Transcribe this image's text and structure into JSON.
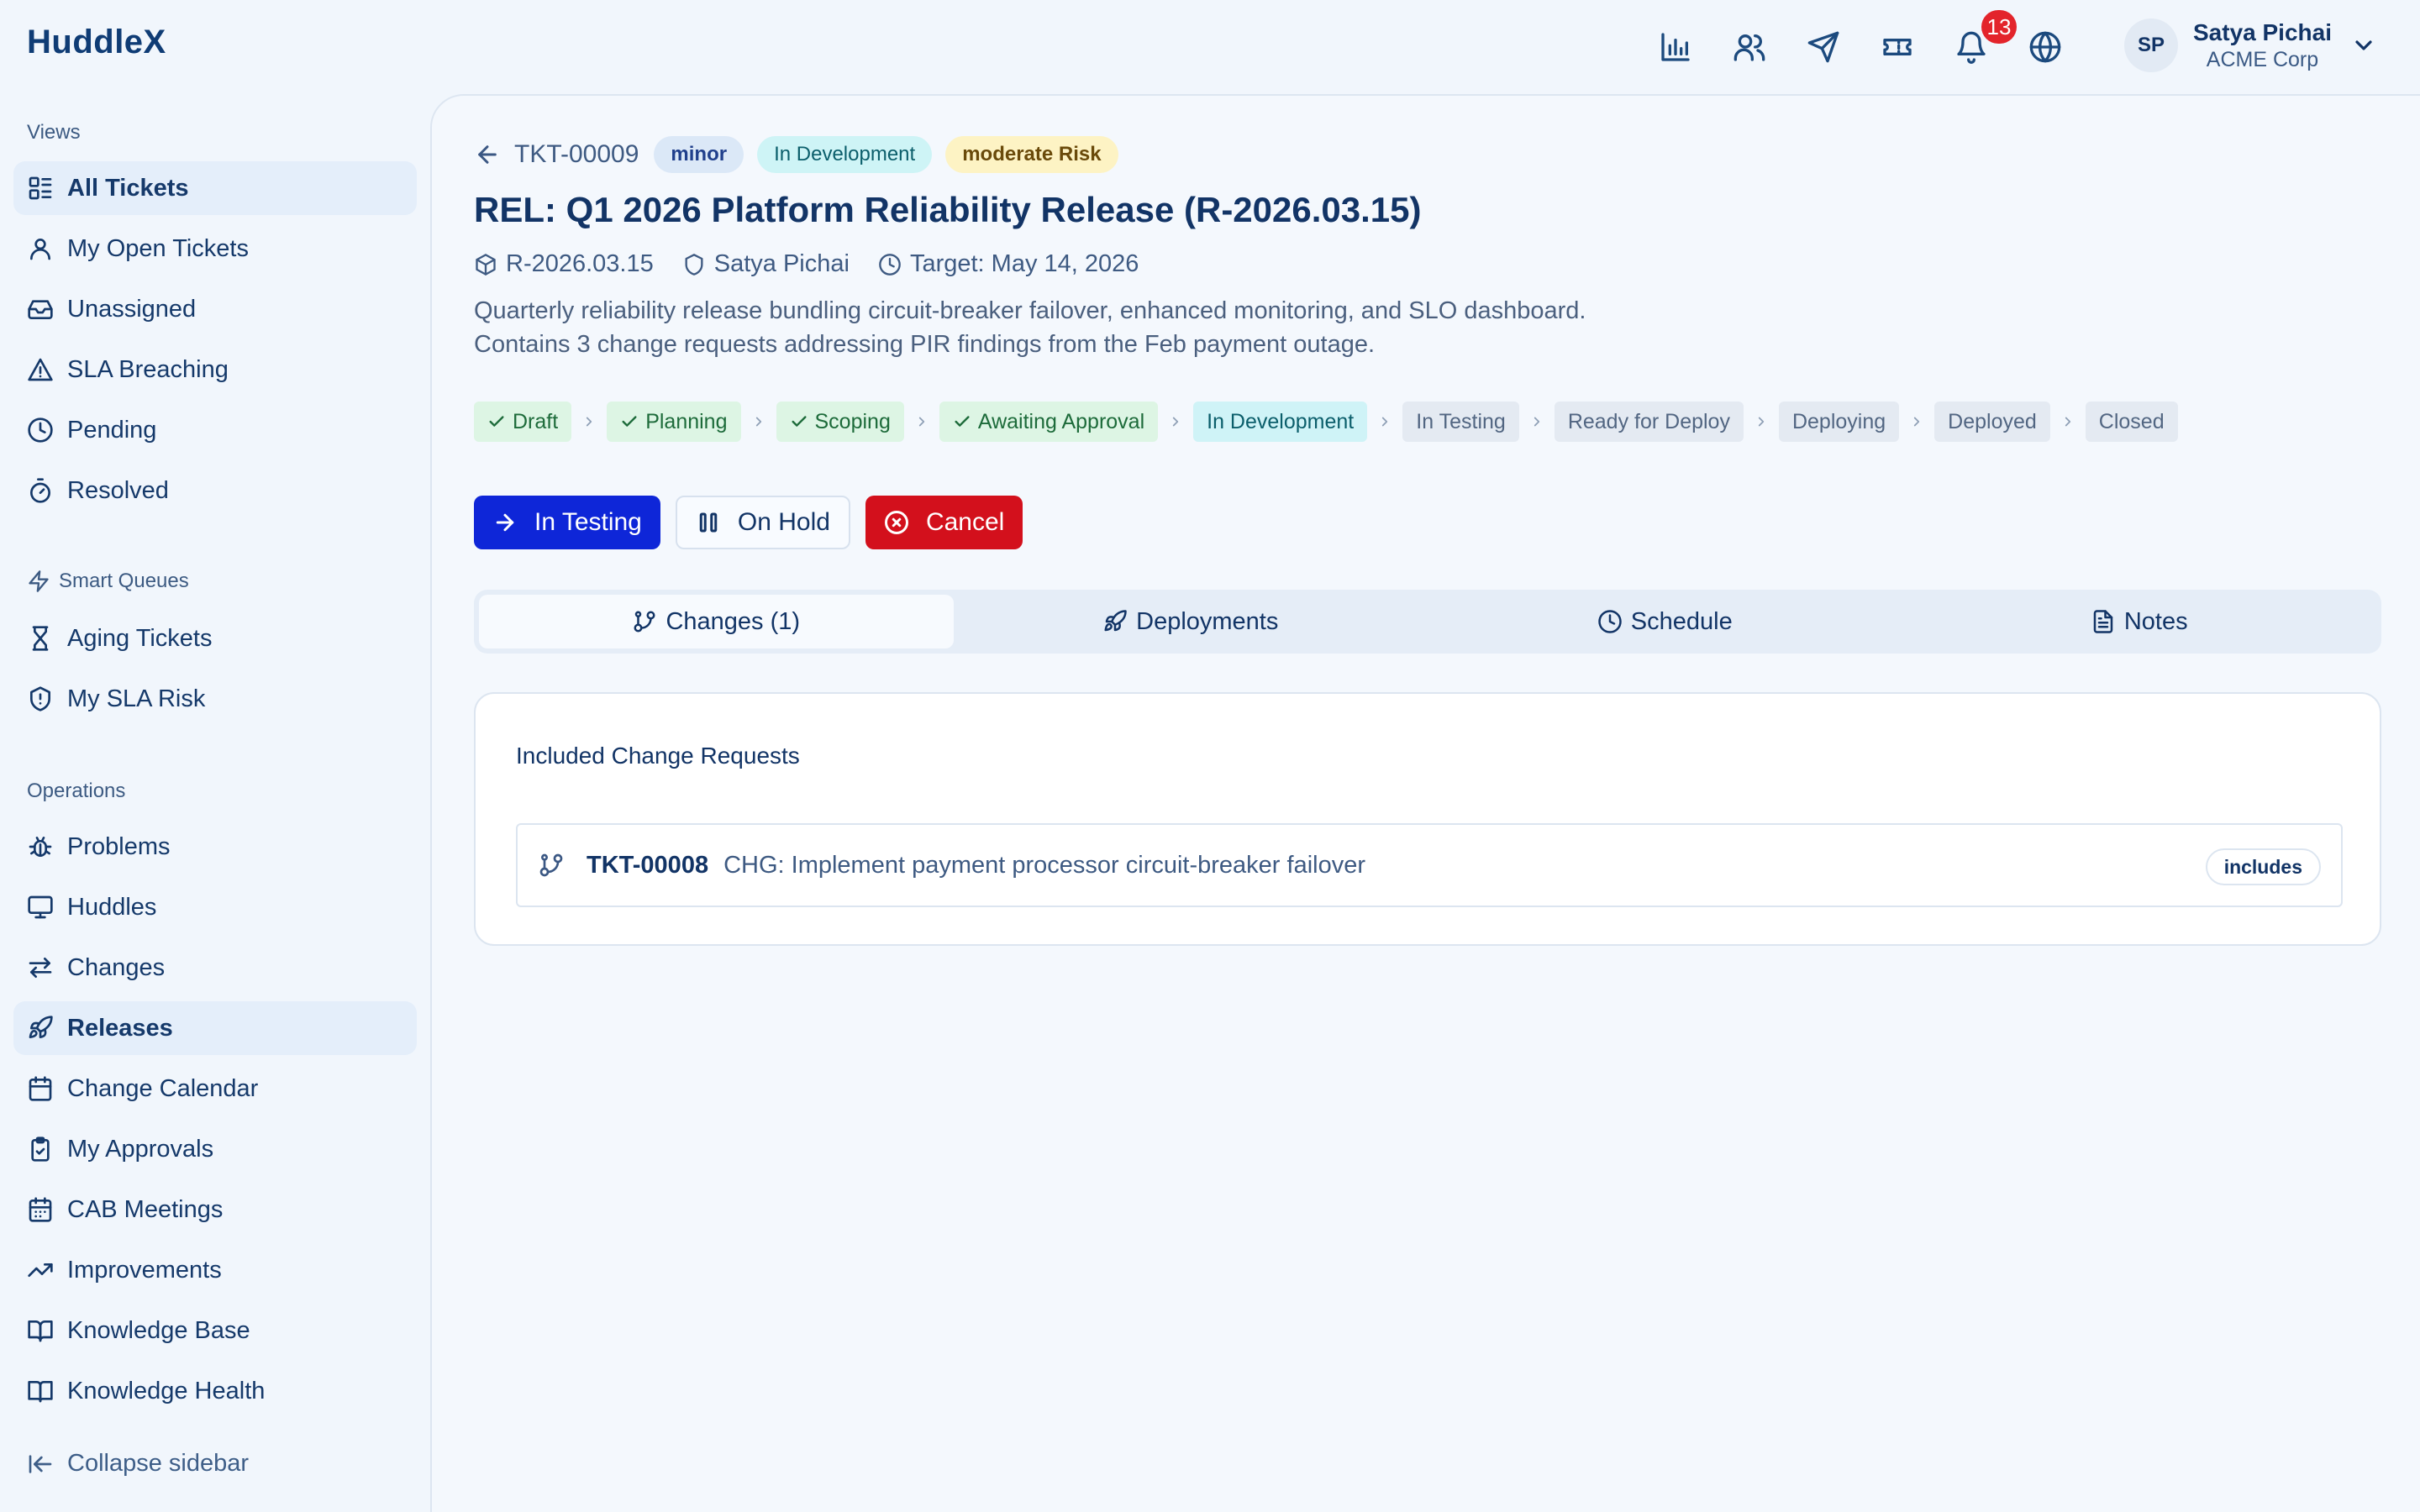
{
  "app": {
    "brand": "HuddleX"
  },
  "header": {
    "icons": [
      "bar-chart-icon",
      "users-icon",
      "send-icon",
      "ticket-icon",
      "bell-icon",
      "globe-icon"
    ],
    "notification_count": "13",
    "user": {
      "initials": "SP",
      "name": "Satya Pichai",
      "org": "ACME Corp"
    }
  },
  "sidebar": {
    "views_label": "Views",
    "views": [
      {
        "label": "All Tickets",
        "icon": "list-icon",
        "active": true
      },
      {
        "label": "My Open Tickets",
        "icon": "user-icon"
      },
      {
        "label": "Unassigned",
        "icon": "inbox-icon"
      },
      {
        "label": "SLA Breaching",
        "icon": "warning-icon"
      },
      {
        "label": "Pending",
        "icon": "clock-icon"
      },
      {
        "label": "Resolved",
        "icon": "timer-icon"
      }
    ],
    "smart_label": "Smart Queues",
    "smart": [
      {
        "label": "Aging Tickets",
        "icon": "hourglass-icon"
      },
      {
        "label": "My SLA Risk",
        "icon": "shield-alert-icon"
      }
    ],
    "ops_label": "Operations",
    "ops": [
      {
        "label": "Problems",
        "icon": "bug-icon"
      },
      {
        "label": "Huddles",
        "icon": "monitor-icon"
      },
      {
        "label": "Changes",
        "icon": "swap-icon"
      },
      {
        "label": "Releases",
        "icon": "rocket-icon",
        "active": true
      },
      {
        "label": "Change Calendar",
        "icon": "calendar-icon"
      },
      {
        "label": "My Approvals",
        "icon": "clipboard-check-icon"
      },
      {
        "label": "CAB Meetings",
        "icon": "calendar-grid-icon"
      },
      {
        "label": "Improvements",
        "icon": "trending-up-icon"
      },
      {
        "label": "Knowledge Base",
        "icon": "book-open-icon"
      },
      {
        "label": "Knowledge Health",
        "icon": "book-icon"
      }
    ],
    "collapse_label": "Collapse sidebar"
  },
  "ticket": {
    "id": "TKT-00009",
    "badges": {
      "severity": "minor",
      "status": "In Development",
      "risk": "moderate Risk"
    },
    "title": "REL: Q1 2026 Platform Reliability Release (R-2026.03.15)",
    "meta": {
      "version": "R-2026.03.15",
      "owner": "Satya Pichai",
      "target": "Target: May 14, 2026"
    },
    "description": "Quarterly reliability release bundling circuit-breaker failover, enhanced monitoring, and SLO dashboard. Contains 3 change requests addressing PIR findings from the Feb payment outage."
  },
  "pipeline": [
    {
      "label": "Draft",
      "state": "done"
    },
    {
      "label": "Planning",
      "state": "done"
    },
    {
      "label": "Scoping",
      "state": "done"
    },
    {
      "label": "Awaiting Approval",
      "state": "done"
    },
    {
      "label": "In Development",
      "state": "current"
    },
    {
      "label": "In Testing",
      "state": "todo"
    },
    {
      "label": "Ready for Deploy",
      "state": "todo"
    },
    {
      "label": "Deploying",
      "state": "todo"
    },
    {
      "label": "Deployed",
      "state": "todo"
    },
    {
      "label": "Closed",
      "state": "todo"
    }
  ],
  "actions": {
    "primary": "In Testing",
    "hold": "On Hold",
    "cancel": "Cancel"
  },
  "tabs": [
    {
      "label": "Changes (1)",
      "icon": "git-branch-icon",
      "active": true
    },
    {
      "label": "Deployments",
      "icon": "rocket-icon"
    },
    {
      "label": "Schedule",
      "icon": "clock-icon"
    },
    {
      "label": "Notes",
      "icon": "document-icon"
    }
  ],
  "changes": {
    "heading": "Included Change Requests",
    "items": [
      {
        "id": "TKT-00008",
        "title": "CHG: Implement payment processor circuit-breaker failover",
        "relation": "includes"
      }
    ]
  },
  "colors": {
    "primary": "#0e26d8",
    "danger": "#d3101c",
    "brand": "#0f3c75",
    "badge": "#e3242b"
  }
}
